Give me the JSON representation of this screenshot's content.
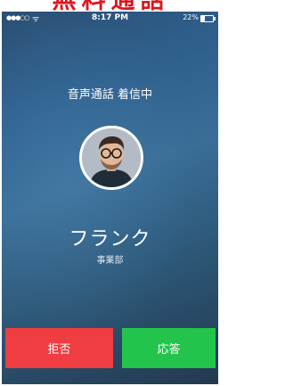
{
  "banner": {
    "text": "無料通話",
    "color": "#e0141e"
  },
  "status_bar": {
    "signal_icon": "signal-dots-icon",
    "signal": "●●●○○",
    "wifi_icon": "wifi-icon",
    "wifi": "ᯤ",
    "time": "8:17 PM",
    "battery": "22%",
    "battery_icon": "battery-icon"
  },
  "call": {
    "status": "音声通話 着信中",
    "caller_name": "フランク",
    "caller_department": "事業部",
    "avatar_icon": "caller-avatar"
  },
  "actions": {
    "decline_label": "拒否",
    "accept_label": "応答",
    "decline_color": "#ef3d42",
    "accept_color": "#23c44b"
  }
}
